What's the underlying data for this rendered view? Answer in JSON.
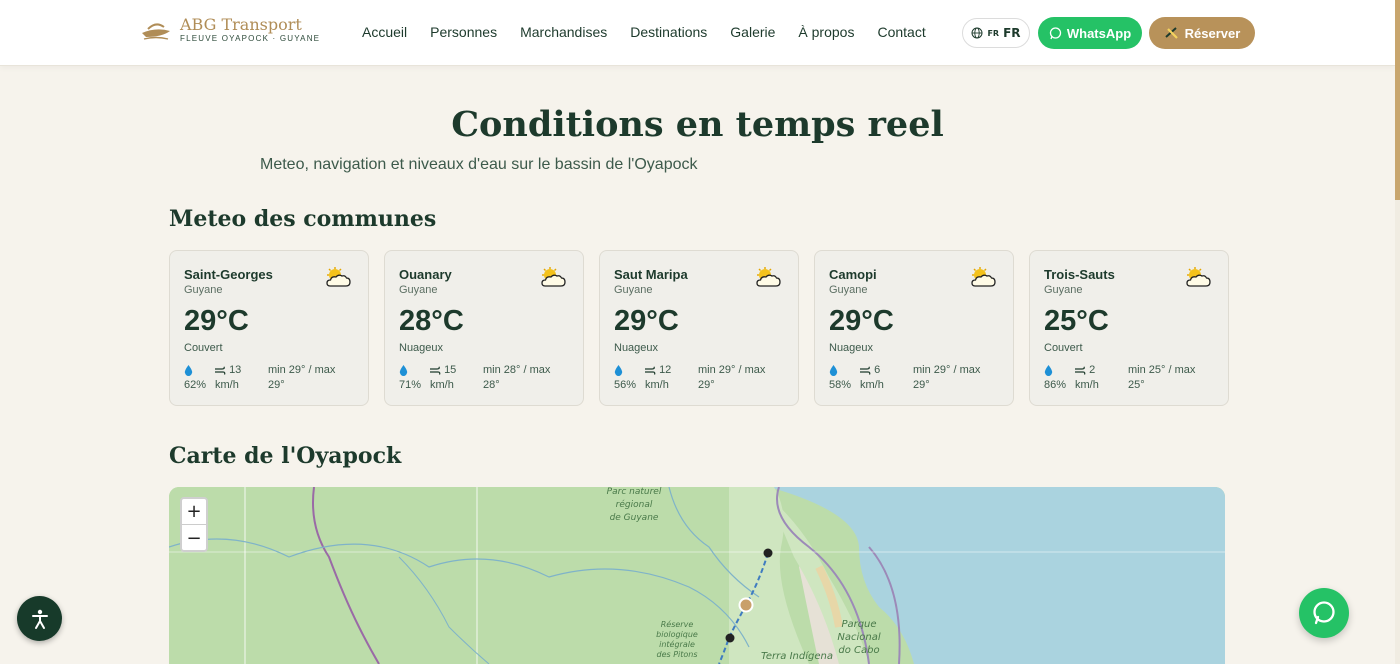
{
  "header": {
    "logo_title": "ABG Transport",
    "logo_subtitle": "FLEUVE OYAPOCK · GUYANE",
    "nav": [
      "Accueil",
      "Personnes",
      "Marchandises",
      "Destinations",
      "Galerie",
      "À propos",
      "Contact"
    ],
    "lang_small": "FR",
    "lang_label": "FR",
    "whatsapp_label": "WhatsApp",
    "reserve_label": "Réserver"
  },
  "hero": {
    "title": "Conditions en temps reel",
    "subtitle": "Meteo, navigation et niveaux d'eau sur le bassin de l'Oyapock"
  },
  "weather": {
    "section_title": "Meteo des communes",
    "cards": [
      {
        "name": "Saint-Georges",
        "region": "Guyane",
        "temp": "29°C",
        "condition": "Couvert",
        "humidity": "62%",
        "wind_value": "13",
        "wind_unit": "km/h",
        "minmax_1": "min 29° / max",
        "minmax_2": "29°"
      },
      {
        "name": "Ouanary",
        "region": "Guyane",
        "temp": "28°C",
        "condition": "Nuageux",
        "humidity": "71%",
        "wind_value": "15",
        "wind_unit": "km/h",
        "minmax_1": "min 28° / max",
        "minmax_2": "28°"
      },
      {
        "name": "Saut Maripa",
        "region": "Guyane",
        "temp": "29°C",
        "condition": "Nuageux",
        "humidity": "56%",
        "wind_value": "12",
        "wind_unit": "km/h",
        "minmax_1": "min 29° / max",
        "minmax_2": "29°"
      },
      {
        "name": "Camopi",
        "region": "Guyane",
        "temp": "29°C",
        "condition": "Nuageux",
        "humidity": "58%",
        "wind_value": "6",
        "wind_unit": "km/h",
        "minmax_1": "min 29° / max",
        "minmax_2": "29°"
      },
      {
        "name": "Trois-Sauts",
        "region": "Guyane",
        "temp": "25°C",
        "condition": "Couvert",
        "humidity": "86%",
        "wind_value": "2",
        "wind_unit": "km/h",
        "minmax_1": "min 25° / max",
        "minmax_2": "25°"
      }
    ]
  },
  "map": {
    "section_title": "Carte de l'Oyapock",
    "zoom_in": "+",
    "zoom_out": "−",
    "labels": {
      "park_1": "Parc naturel",
      "park_2": "régional",
      "park_3": "de Guyane",
      "reserve_1": "Réserve",
      "reserve_2": "biologique",
      "reserve_3": "intégrale",
      "reserve_4": "des Pitons",
      "cabo_1": "Parque",
      "cabo_2": "Nacional",
      "cabo_3": "do Cabo",
      "terra": "Terra Indígena"
    }
  },
  "colors": {
    "primary": "#1d3a2c",
    "gold": "#b8925a",
    "whatsapp": "#25c266",
    "background": "#f6f3ec"
  }
}
